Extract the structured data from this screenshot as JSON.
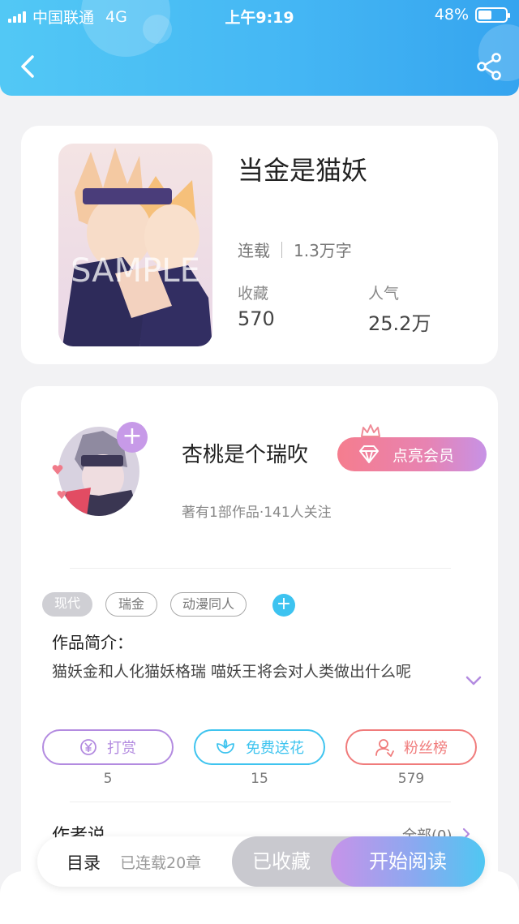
{
  "status_bar": {
    "carrier": "中国联通",
    "network": "4G",
    "time": "上午9:19",
    "battery": "48%",
    "battery_level": 0.48
  },
  "nav": {
    "back_icon": "chevron-left-icon",
    "share_icon": "share-icon"
  },
  "book": {
    "title": "当金是猫妖",
    "cover_watermark": "SAMPLE",
    "status": "连载",
    "word_count": "1.3万字",
    "favorites_label": "收藏",
    "favorites_value": "570",
    "popularity_label": "人气",
    "popularity_value": "25.2万"
  },
  "author": {
    "name": "杏桃是个瑞吹",
    "follow_icon": "plus-icon",
    "vip_button": "点亮会员",
    "meta": "著有1部作品·141人关注"
  },
  "tags": [
    "现代",
    "瑞金",
    "动漫同人"
  ],
  "intro": {
    "heading": "作品简介：",
    "text": "猫妖金和人化猫妖格瑞 喵妖王将会对人类做出什么呢"
  },
  "actions": [
    {
      "label": "打赏",
      "count": "5",
      "color": "#b38be0",
      "icon": "yen-icon"
    },
    {
      "label": "免费送花",
      "count": "15",
      "color": "#3fc4ef",
      "icon": "flower-icon"
    },
    {
      "label": "粉丝榜",
      "count": "579",
      "color": "#f07b7b",
      "icon": "user-icon"
    }
  ],
  "author_says": {
    "heading": "作者说",
    "all_link": "全部(0)"
  },
  "bottom_bar": {
    "toc": "目录",
    "toc_status": "已连载20章",
    "favorited": "已收藏",
    "start_reading": "开始阅读"
  },
  "colors": {
    "header_start": "#52c8f5",
    "header_end": "#35a4ef",
    "accent_purple": "#c79ae8",
    "accent_blue": "#3dc3f0"
  }
}
